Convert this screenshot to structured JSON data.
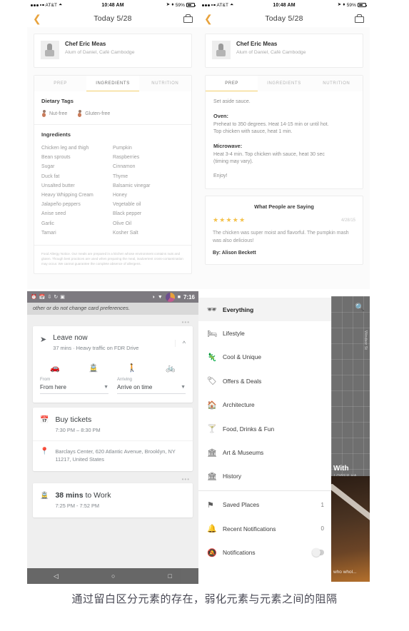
{
  "panel1": {
    "status": {
      "carrier": "AT&T",
      "time": "10:48 AM",
      "battery": "59%"
    },
    "nav": {
      "back_icon": "chevron-left-icon",
      "title": "Today 5/28",
      "bag_icon": "shopping-bag-icon"
    },
    "chef": {
      "name": "Chef Eric Meas",
      "subtitle": "Alum of Daniel, Café Cambodge"
    },
    "tabs": [
      {
        "label": "PREP",
        "active": false
      },
      {
        "label": "INGREDIENTS",
        "active": true
      },
      {
        "label": "NUTRITION",
        "active": false
      }
    ],
    "dietary": {
      "heading": "Dietary Tags",
      "tags": [
        {
          "label": "Nut-free"
        },
        {
          "label": "Gluten-free"
        }
      ]
    },
    "ingredients": {
      "heading": "Ingredients",
      "col1": [
        "Chicken leg and thigh",
        "Bean sprouts",
        "Sugar",
        "Duck fat",
        "Unsalted butter",
        "Heavy Whipping Cream",
        "Jalapeño peppers",
        "Anise seed",
        "Garlic",
        "Tamari"
      ],
      "col2": [
        "Pumpkin",
        "Raspberries",
        "Cinnamon",
        "Thyme",
        "Balsamic vinegar",
        "Honey",
        "Vegetable oil",
        "Black pepper",
        "Olive Oil",
        "Kosher Salt"
      ]
    },
    "disclaimer": "Food Allergy Notice. Our meals are prepared in a kitchen whose environment contains nuts and gluten. Though best practices are used when preparing the meal, inadvertent cross-contamination may occur. We cannot guarantee the complete absence of allergens."
  },
  "panel2": {
    "status": {
      "carrier": "AT&T",
      "time": "10:48 AM",
      "battery": "59%"
    },
    "nav": {
      "back_icon": "chevron-left-icon",
      "title": "Today 5/28",
      "bag_icon": "shopping-bag-icon"
    },
    "chef": {
      "name": "Chef Eric Meas",
      "subtitle": "Alum of Daniel, Café Cambodge"
    },
    "tabs": [
      {
        "label": "PREP",
        "active": true
      },
      {
        "label": "INGREDIENTS",
        "active": false
      },
      {
        "label": "NUTRITION",
        "active": false
      }
    ],
    "prep": {
      "intro": "Set aside sauce.",
      "oven_heading": "Oven:",
      "oven_line1": "Preheat to 350 degrees. Heat 14-15 min or until hot.",
      "oven_line2": "Top chicken with sauce, heat 1 min.",
      "micro_heading": "Microwave:",
      "micro_line1": "Heat 3-4 min.  Top chicken with sauce, heat 30 sec",
      "micro_line2": "(timing may vary).",
      "outro": "Enjoy!"
    },
    "reviews": {
      "title": "What People are Saying",
      "stars": "★★★★★",
      "date": "4/28/15",
      "text": "The chicken was super moist and flavorful. The pumpkin mash was also delicious!",
      "author": "By: Alison Beckett"
    }
  },
  "panel3": {
    "status": {
      "time": "7:16",
      "icons": [
        "alarm-icon",
        "calendar-icon",
        "download-icon",
        "sync-icon",
        "screenshot-icon",
        "battery-saver-icon",
        "wifi-icon",
        "signal-icon",
        "battery-icon"
      ]
    },
    "notification": "other or do not change card preferences.",
    "leave": {
      "title": "Leave now",
      "subtitle": "37 mins · Heavy traffic on FDR Drive",
      "nav_icon": "navigation-arrow-icon",
      "collapse_icon": "chevron-up-icon"
    },
    "modes": [
      {
        "name": "drive-mode",
        "icon": "car-icon",
        "active": true
      },
      {
        "name": "transit-mode",
        "icon": "train-icon",
        "active": false
      },
      {
        "name": "walk-mode",
        "icon": "walk-icon",
        "active": false
      },
      {
        "name": "bike-mode",
        "icon": "bike-icon",
        "active": false
      }
    ],
    "from_field": {
      "label": "From",
      "value": "From here"
    },
    "arriving_field": {
      "label": "Arriving",
      "value": "Arrive on time"
    },
    "tickets": {
      "icon": "calendar-icon",
      "title": "Buy tickets",
      "time": "7:30 PM – 8:30 PM",
      "location_icon": "map-pin-icon",
      "address": "Barclays Center, 620 Atlantic Avenue, Brooklyn, NY 11217, United States"
    },
    "work": {
      "icon": "train-icon",
      "duration": "38 mins",
      "destination": " to Work",
      "time": "7:25 PM - 7:52 PM"
    },
    "navbar": {
      "back": "◁",
      "home": "○",
      "recents": "□"
    }
  },
  "panel4": {
    "menu": [
      {
        "label": "Everything",
        "icon": "binoculars-icon",
        "selected": true,
        "count": ""
      },
      {
        "label": "Lifestyle",
        "icon": "sofa-icon",
        "selected": false,
        "count": ""
      },
      {
        "label": "Cool & Unique",
        "icon": "dino-icon",
        "selected": false,
        "count": ""
      },
      {
        "label": "Offers & Deals",
        "icon": "tag-icon",
        "selected": false,
        "count": ""
      },
      {
        "label": "Architecture",
        "icon": "building-icon",
        "selected": false,
        "count": ""
      },
      {
        "label": "Food, Drinks & Fun",
        "icon": "drink-icon",
        "selected": false,
        "count": ""
      },
      {
        "label": "Art & Museums",
        "icon": "statue-icon",
        "selected": false,
        "count": ""
      },
      {
        "label": "History",
        "icon": "column-icon",
        "selected": false,
        "count": ""
      }
    ],
    "menu2": [
      {
        "label": "Saved Places",
        "icon": "flag-icon",
        "count": "1"
      },
      {
        "label": "Recent Notifications",
        "icon": "bell-icon",
        "count": "0"
      }
    ],
    "toggle_row": {
      "label": "Notifications",
      "icon": "bell-off-icon",
      "enabled": false
    },
    "map": {
      "search_icon": "search-icon",
      "street": "Windsor St",
      "area": "LOWER HA",
      "photo_title": "With",
      "photo_caption": "who whol..."
    }
  },
  "caption": "通过留白区分元素的存在，弱化元素与元素之间的阻隔"
}
